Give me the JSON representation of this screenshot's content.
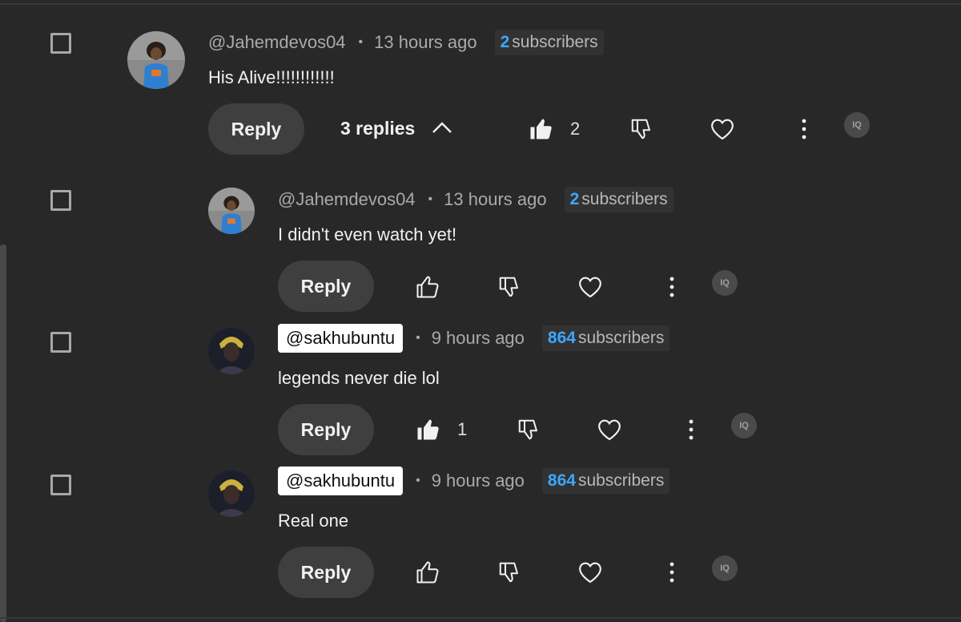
{
  "comments": [
    {
      "handle": "@Jahemdevos04",
      "time": "13 hours ago",
      "subs_count": "2",
      "subs_label": "subscribers",
      "text": "His Alive!!!!!!!!!!!!",
      "reply_label": "Reply",
      "replies_label": "3 replies",
      "like_count": "2",
      "liked": true
    },
    {
      "handle": "@Jahemdevos04",
      "time": "13 hours ago",
      "subs_count": "2",
      "subs_label": "subscribers",
      "text": "I didn't even watch yet!",
      "reply_label": "Reply",
      "liked": false
    },
    {
      "handle": "@sakhubuntu",
      "time": "9 hours ago",
      "subs_count": "864",
      "subs_label": "subscribers",
      "text": "legends never die lol",
      "reply_label": "Reply",
      "like_count": "1",
      "liked": true
    },
    {
      "handle": "@sakhubuntu",
      "time": "9 hours ago",
      "subs_count": "864",
      "subs_label": "subscribers",
      "text": "Real one",
      "reply_label": "Reply",
      "liked": false
    }
  ],
  "separator": "•",
  "iq_badge": "IQ",
  "icons": {
    "like": "thumbs-up-icon",
    "dislike": "thumbs-down-icon",
    "heart": "heart-icon",
    "more": "more-vertical-icon",
    "collapse": "chevron-up-icon"
  },
  "colors": {
    "background": "#282828",
    "subscriber_count": "#3ea6ff",
    "reply_button": "#3f3f3f"
  }
}
